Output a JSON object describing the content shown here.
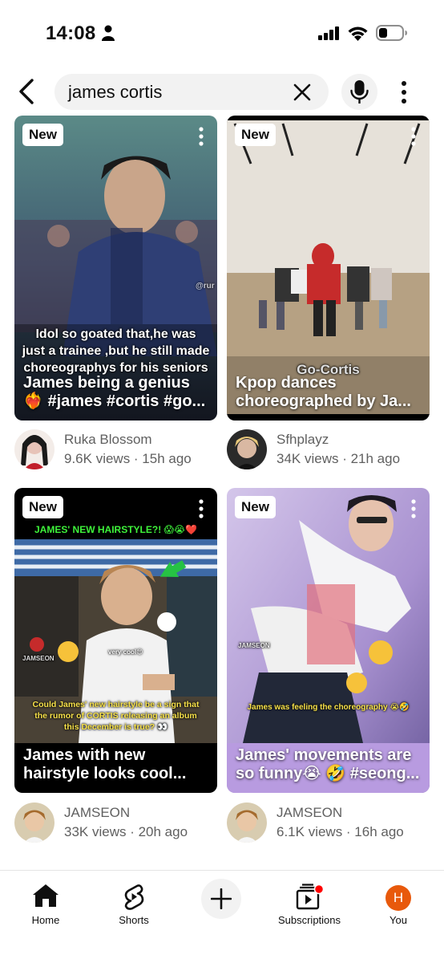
{
  "status_bar": {
    "time": "14:08"
  },
  "search": {
    "query": "james cortis"
  },
  "colors": {
    "accent_red": "#ff0000",
    "you_avatar_bg": "#e8590c",
    "secondary_text": "#606060"
  },
  "results": [
    {
      "badge": "New",
      "title": "James being a genius\n❤️‍🔥 #james #cortis #go...",
      "overlay_text": "Idol so goated that,he was\njust a trainee ,but he still made\nchoreographys for his seniors",
      "watermark": "@rur",
      "channel": "Ruka Blossom",
      "stats": "9.6K views · 15h ago"
    },
    {
      "badge": "New",
      "title": "Kpop dances\nchoreographed by Ja...",
      "overlay_text": "Go-Cortis",
      "channel": "Sfhplayz",
      "stats": "34K views · 21h ago"
    },
    {
      "badge": "New",
      "title": "James with new\nhairstyle looks cool...",
      "overlay_heading": "JAMES' NEW HAIRSTYLE?! 😱😭❤️",
      "overlay_caption": "Could James' new hairstyle be a sign that\nthe rumor of CORTIS releasing an album\nthis December is true? 👀",
      "overlay_small": "very cool😍",
      "watermark": "JAMSEON",
      "channel": "JAMSEON",
      "stats": "33K views · 20h ago"
    },
    {
      "badge": "New",
      "title": "James' movements are\nso funny😭 🤣 #seong...",
      "overlay_caption": "James was feeling the choreography 😭🤣",
      "watermark": "JAMSEON",
      "channel": "JAMSEON",
      "stats": "6.1K views · 16h ago"
    }
  ],
  "bottom_nav": {
    "items": [
      {
        "label": "Home",
        "icon": "home-icon"
      },
      {
        "label": "Shorts",
        "icon": "shorts-icon"
      },
      {
        "label": "",
        "icon": "plus-icon"
      },
      {
        "label": "Subscriptions",
        "icon": "subscriptions-icon"
      },
      {
        "label": "You",
        "icon": "avatar"
      }
    ],
    "you_initial": "H"
  }
}
